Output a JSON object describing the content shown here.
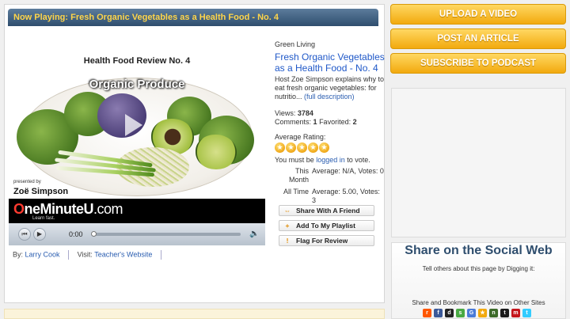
{
  "header": {
    "title": "Now Playing: Fresh Organic Vegetables as a Health Food - No. 4"
  },
  "video": {
    "frame_title": "Health Food Review No. 4",
    "overlay_label": "Organic Produce",
    "presented_by": "presented by",
    "presenter": "Zoë Simpson",
    "brand_prefix": "O",
    "brand_name": "neMinuteU",
    "brand_suffix": ".com",
    "tagline": "Learn fast.",
    "time": "0:00",
    "progress": 0
  },
  "meta": {
    "by_label": "By:",
    "author": "Larry Cook",
    "visit_label": "Visit:",
    "visit_link": "Teacher's Website"
  },
  "info": {
    "category": "Green Living",
    "title": "Fresh Organic Vegetables as a Health Food - No. 4",
    "description": "Host Zoe Simpson explains why to eat fresh organic vegetables: for nutritio...",
    "full_link": "(full description)",
    "views_label": "Views:",
    "views": "3784",
    "comments_label": "Comments:",
    "comments": "1",
    "favorited_label": "Favorited:",
    "favorited": "2",
    "rating_label": "Average Rating:",
    "rating_value": 5,
    "must_be": "You must be",
    "logged_in": "logged in",
    "to_vote": "to vote.",
    "this_month_label": "This Month",
    "this_month_value": "Average: N/A, Votes: 0",
    "all_time_label": "All Time",
    "all_time_value": "Average: 5.00, Votes: 3"
  },
  "actions": {
    "share": "Share With A Friend",
    "playlist": "Add To My Playlist",
    "flag": "Flag For Review"
  },
  "sidebar": {
    "upload": "UPLOAD A VIDEO",
    "post": "POST AN ARTICLE",
    "subscribe": "SUBSCRIBE TO PODCAST",
    "share_title": "Share on the Social Web",
    "share_sub": "Tell others about this page by Digging it:",
    "bookmark_label": "Share and Bookmark This Video on Other Sites"
  },
  "social_icons": [
    "reddit-icon",
    "facebook-icon",
    "delicious-icon",
    "stumbleupon-icon",
    "google-icon",
    "favorites-icon",
    "newsvine-icon",
    "technorati-icon",
    "mixx-icon",
    "twitter-icon"
  ],
  "colors": {
    "title_bar": "#2f4e6e",
    "title_text": "#ffd54a",
    "button_orange": "#f2a90e",
    "link": "#1f58c8"
  }
}
